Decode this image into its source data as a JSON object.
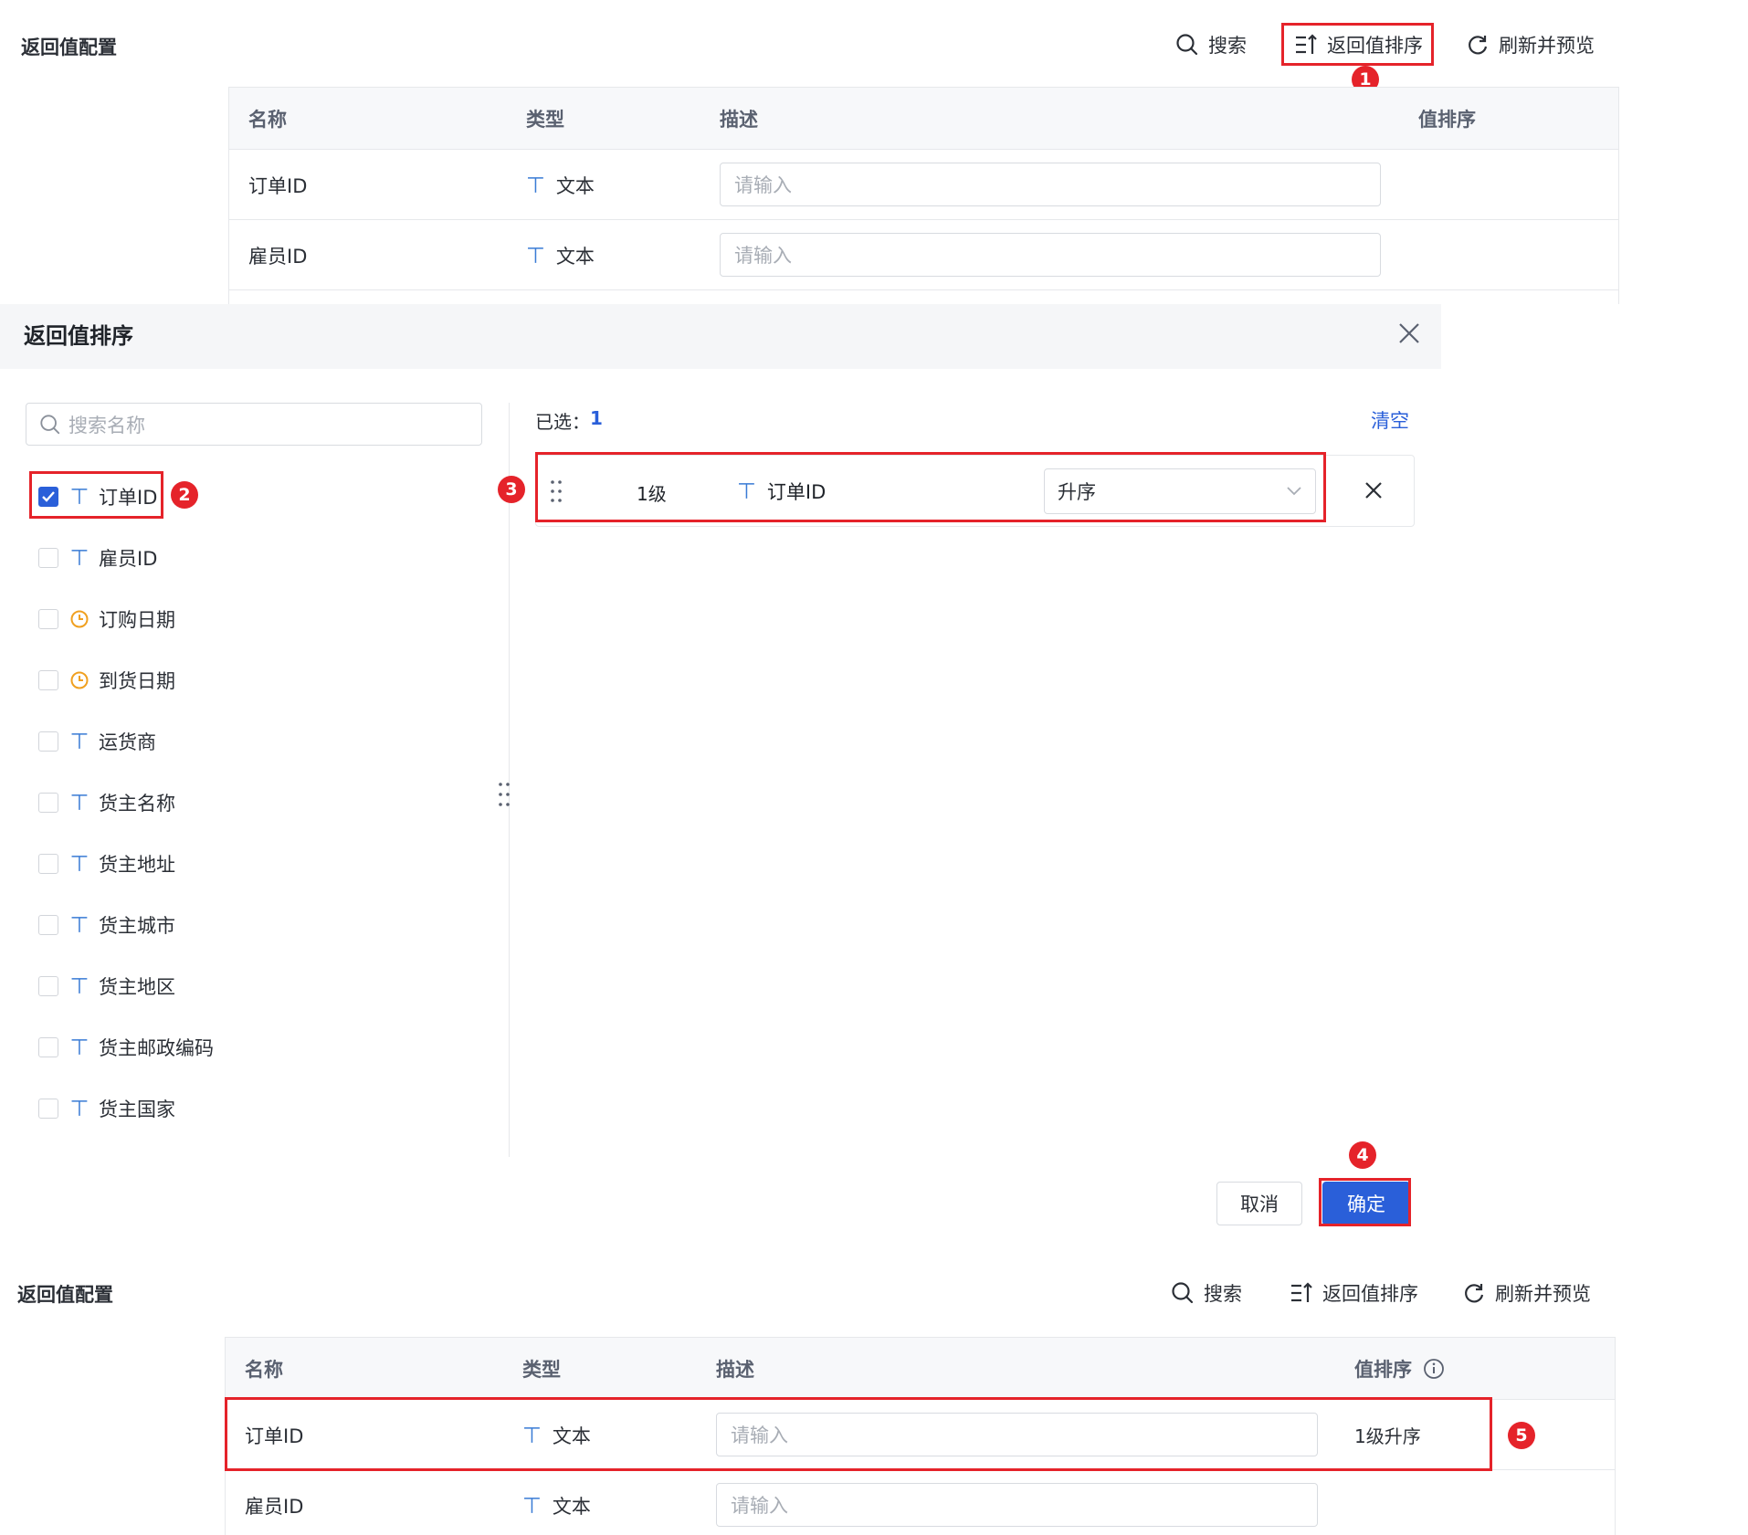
{
  "top_section": {
    "title": "返回值配置",
    "toolbar": {
      "search": "搜索",
      "sort": "返回值排序",
      "refresh": "刷新并预览"
    },
    "table": {
      "headers": {
        "name": "名称",
        "type": "类型",
        "desc": "描述",
        "sort": "值排序"
      },
      "rows": [
        {
          "name": "订单ID",
          "type": "文本",
          "desc_placeholder": "请输入"
        },
        {
          "name": "雇员ID",
          "type": "文本",
          "desc_placeholder": "请输入"
        }
      ]
    }
  },
  "dialog": {
    "title": "返回值排序",
    "search_placeholder": "搜索名称",
    "fields": [
      {
        "label": "订单ID",
        "icon": "text-type",
        "checked": true
      },
      {
        "label": "雇员ID",
        "icon": "text-type",
        "checked": false
      },
      {
        "label": "订购日期",
        "icon": "date-type",
        "checked": false
      },
      {
        "label": "到货日期",
        "icon": "date-type",
        "checked": false
      },
      {
        "label": "运货商",
        "icon": "text-type",
        "checked": false
      },
      {
        "label": "货主名称",
        "icon": "text-type",
        "checked": false
      },
      {
        "label": "货主地址",
        "icon": "text-type",
        "checked": false
      },
      {
        "label": "货主城市",
        "icon": "text-type",
        "checked": false
      },
      {
        "label": "货主地区",
        "icon": "text-type",
        "checked": false
      },
      {
        "label": "货主邮政编码",
        "icon": "text-type",
        "checked": false
      },
      {
        "label": "货主国家",
        "icon": "text-type",
        "checked": false
      }
    ],
    "selected_label": "已选：",
    "selected_count": "1",
    "clear": "清空",
    "selected_row": {
      "level": "1级",
      "field": "订单ID",
      "order": "升序"
    },
    "cancel": "取消",
    "confirm": "确定"
  },
  "bottom_section": {
    "title": "返回值配置",
    "toolbar": {
      "search": "搜索",
      "sort": "返回值排序",
      "refresh": "刷新并预览"
    },
    "table": {
      "headers": {
        "name": "名称",
        "type": "类型",
        "desc": "描述",
        "sort": "值排序"
      },
      "rows": [
        {
          "name": "订单ID",
          "type": "文本",
          "desc_placeholder": "请输入",
          "sort": "1级升序"
        },
        {
          "name": "雇员ID",
          "type": "文本",
          "desc_placeholder": "请输入",
          "sort": ""
        }
      ]
    }
  },
  "badges": [
    "1",
    "2",
    "3",
    "4",
    "5"
  ],
  "colors": {
    "accent": "#2a5fd9",
    "highlight": "#e5232a",
    "type_icon": "#3a7bd5",
    "date_icon": "#f0a020"
  }
}
